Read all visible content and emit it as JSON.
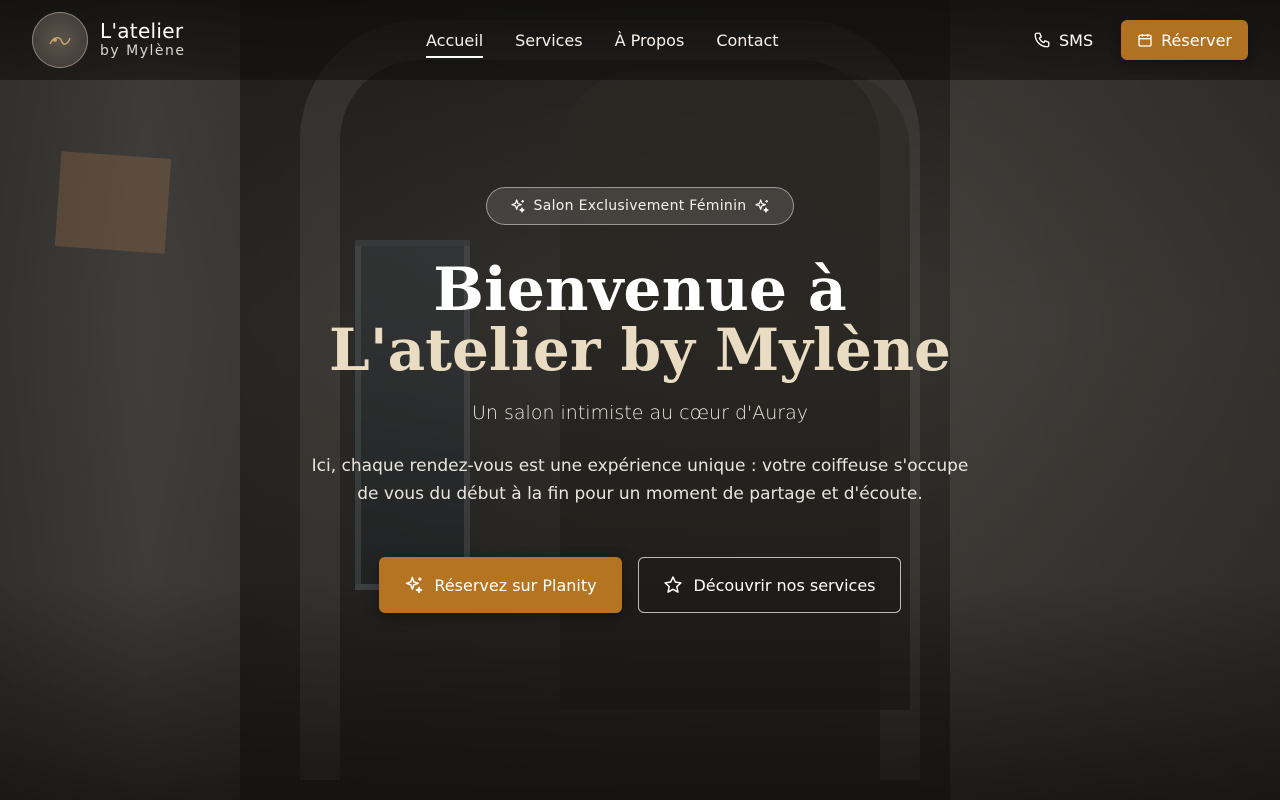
{
  "brand": {
    "name": "L'atelier",
    "sub": "by Mylène"
  },
  "nav": {
    "items": [
      {
        "label": "Accueil",
        "active": true
      },
      {
        "label": "Services",
        "active": false
      },
      {
        "label": "À Propos",
        "active": false
      },
      {
        "label": "Contact",
        "active": false
      }
    ]
  },
  "header_actions": {
    "sms_label": "SMS",
    "sms_icon": "phone-icon",
    "reserve_label": "Réserver",
    "reserve_icon": "calendar-icon"
  },
  "hero": {
    "badge": "Salon Exclusivement Féminin",
    "badge_icon": "sparkles-icon",
    "title_line1": "Bienvenue à",
    "title_line2": "L'atelier by Mylène",
    "subtitle": "Un salon intimiste au cœur d'Auray",
    "description": "Ici, chaque rendez-vous est une expérience unique : votre coiffeuse s'occupe de vous du début à la fin pour un moment de partage et d'écoute.",
    "primary_cta": "Réservez sur Planity",
    "primary_cta_icon": "sparkles-icon",
    "secondary_cta": "Découvrir nos services",
    "secondary_cta_icon": "star-icon"
  },
  "colors": {
    "accent": "#b07220",
    "title_accent": "#e9dcc2"
  }
}
